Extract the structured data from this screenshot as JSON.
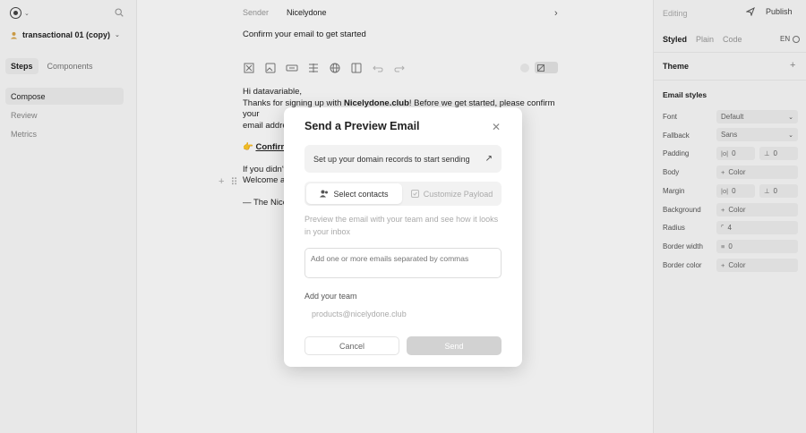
{
  "app": {
    "project_name": "transactional 01 (copy)"
  },
  "left_panel": {
    "tabs": [
      {
        "label": "Steps",
        "active": true
      },
      {
        "label": "Components",
        "active": false
      }
    ],
    "nav": [
      {
        "label": "Compose",
        "active": true
      },
      {
        "label": "Review",
        "active": false
      },
      {
        "label": "Metrics",
        "active": false
      }
    ]
  },
  "editor": {
    "sender_label": "Sender",
    "sender_value": "Nicelydone",
    "subject": "Confirm your email to get started",
    "body": {
      "greeting": "Hi datavariable,",
      "line1_pre": "Thanks for signing up with ",
      "line1_brand": "Nicelydone.club",
      "line1_post": "! Before we get started, please confirm your",
      "line2": "email addre",
      "cta_emoji": "👉",
      "cta": "Confirm ",
      "line3": "If you didn't",
      "line4": "Welcome al",
      "signoff": "— The Nice"
    }
  },
  "right_panel": {
    "editing_label": "Editing",
    "publish_label": "Publish",
    "style_tabs": [
      {
        "label": "Styled",
        "active": true
      },
      {
        "label": "Plain",
        "active": false
      },
      {
        "label": "Code",
        "active": false
      }
    ],
    "language": "EN",
    "theme_label": "Theme",
    "email_styles_label": "Email styles",
    "props": {
      "font_label": "Font",
      "font_value": "Default",
      "fallback_label": "Fallback",
      "fallback_value": "Sans",
      "padding_label": "Padding",
      "padding_x": "0",
      "padding_y": "0",
      "body_label": "Body",
      "body_value": "Color",
      "margin_label": "Margin",
      "margin_x": "0",
      "margin_y": "0",
      "background_label": "Background",
      "background_value": "Color",
      "radius_label": "Radius",
      "radius_value": "4",
      "border_width_label": "Border width",
      "border_width_value": "0",
      "border_color_label": "Border color",
      "border_color_value": "Color"
    }
  },
  "modal": {
    "title": "Send a Preview Email",
    "setup_text": "Set up your domain records to start sending",
    "tabs": [
      {
        "label": "Select contacts",
        "active": true
      },
      {
        "label": "Customize Payload",
        "active": false
      }
    ],
    "description": "Preview the email with your team and see how it looks in your inbox",
    "email_placeholder": "Add one or more emails separated by commas",
    "team_label": "Add your team",
    "team_value": "products@nicelydone.club",
    "cancel_label": "Cancel",
    "send_label": "Send"
  },
  "colors": {
    "send_disabled": "#d2d2d2",
    "panel_bg": "#fafafa",
    "field_bg": "#efefef"
  }
}
